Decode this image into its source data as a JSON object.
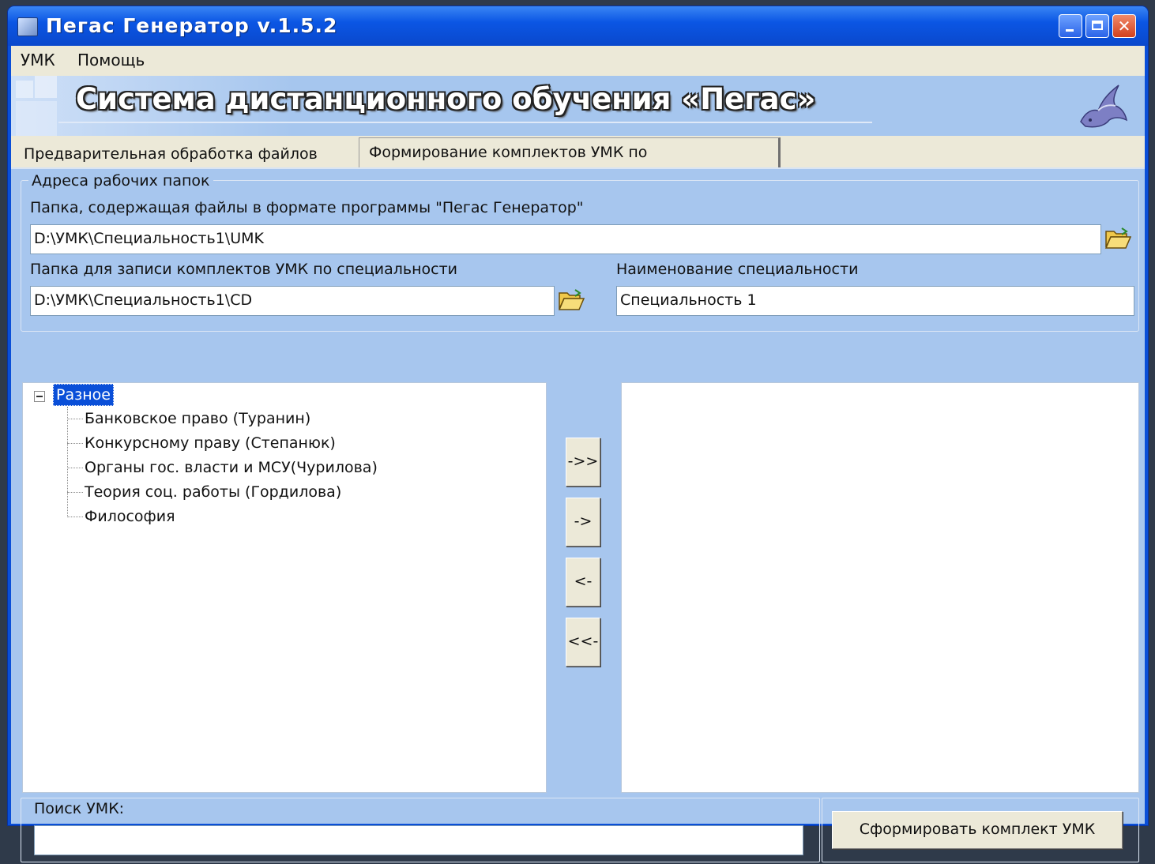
{
  "window": {
    "title": "Пегас Генератор v.1.5.2",
    "controls": {
      "minimize": "minimize-icon",
      "maximize": "maximize-icon",
      "close": "✕"
    }
  },
  "menu": {
    "items": [
      "УМК",
      "Помощь"
    ]
  },
  "banner": {
    "title": "Система дистанционного обучения «Пегас»",
    "logo_icon": "pegasus-logo"
  },
  "tabs": [
    {
      "label": "Предварительная обработка файлов УМК",
      "active": false
    },
    {
      "label": "Формирование комплектов УМК по специальности",
      "active": true
    }
  ],
  "folders_group": {
    "caption": "Адреса рабочих папок",
    "source_label": "Папка, содержащая файлы в формате программы \"Пегас Генератор\"",
    "source_value": "D:\\УМК\\Специальность1\\UMK",
    "output_label": "Папка для записи комплектов УМК по специальности",
    "output_value": "D:\\УМК\\Специальность1\\CD",
    "specialty_label": "Наименование специальности",
    "specialty_value": "Специальность 1"
  },
  "tree": {
    "root": "Разное",
    "items": [
      "Банковское право (Туранин)",
      "Конкурсному праву (Степанюк)",
      "Органы гос. власти и МСУ(Чурилова)",
      "Теория соц. работы (Гордилова)",
      "Философия"
    ]
  },
  "transfer_buttons": {
    "move_all_right": "->>",
    "move_right": "->",
    "move_left": "<-",
    "move_all_left": "<<-"
  },
  "search": {
    "label": "Поиск УМК:",
    "value": ""
  },
  "actions": {
    "build_label": "Сформировать комплект УМК"
  },
  "colors": {
    "titlebar": "#0a4fd8",
    "panel": "#a7c6ee",
    "face": "#ece9d8",
    "selection": "#0a4fd8"
  }
}
